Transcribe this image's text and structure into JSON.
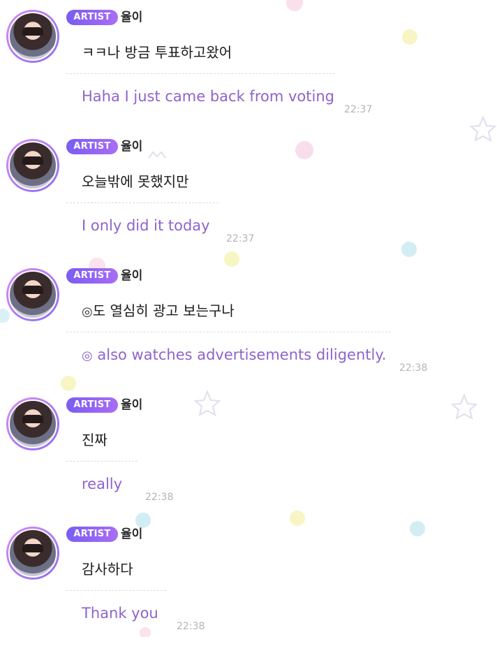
{
  "messages": [
    {
      "badge": "ARTIST",
      "name": "율이",
      "original": "ㅋㅋ나 방금 투표하고왔어",
      "translation": "Haha I just came back from voting",
      "time": "22:37"
    },
    {
      "badge": "ARTIST",
      "name": "율이",
      "original": "오늘밖에 못했지만",
      "translation": "I only did it today",
      "time": "22:37"
    },
    {
      "badge": "ARTIST",
      "name": "율이",
      "original_emoji": "◎",
      "original": "도 열심히 광고 보는구나",
      "translation_emoji": "◎",
      "translation": " also watches advertisements diligently.",
      "time": "22:38"
    },
    {
      "badge": "ARTIST",
      "name": "율이",
      "original": "진짜",
      "translation": "really",
      "time": "22:38"
    },
    {
      "badge": "ARTIST",
      "name": "율이",
      "original": "감사하다",
      "translation": "Thank you",
      "time": "22:38"
    }
  ],
  "colors": {
    "badge_start": "#7a5cf2",
    "badge_end": "#a96df5",
    "translation_text": "#8e63cc",
    "timestamp": "#b4b4b4"
  }
}
